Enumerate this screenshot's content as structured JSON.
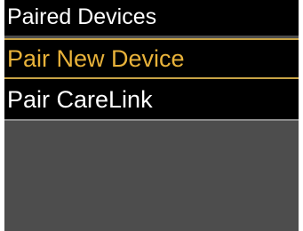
{
  "header": {
    "title": "Paired Devices"
  },
  "menu": {
    "items": [
      {
        "label": "Pair New Device",
        "selected": true
      },
      {
        "label": "Pair CareLink",
        "selected": false
      }
    ]
  },
  "colors": {
    "background": "#4d4d4d",
    "bar": "#000000",
    "text": "#ffffff",
    "highlight": "#e8b23a"
  }
}
